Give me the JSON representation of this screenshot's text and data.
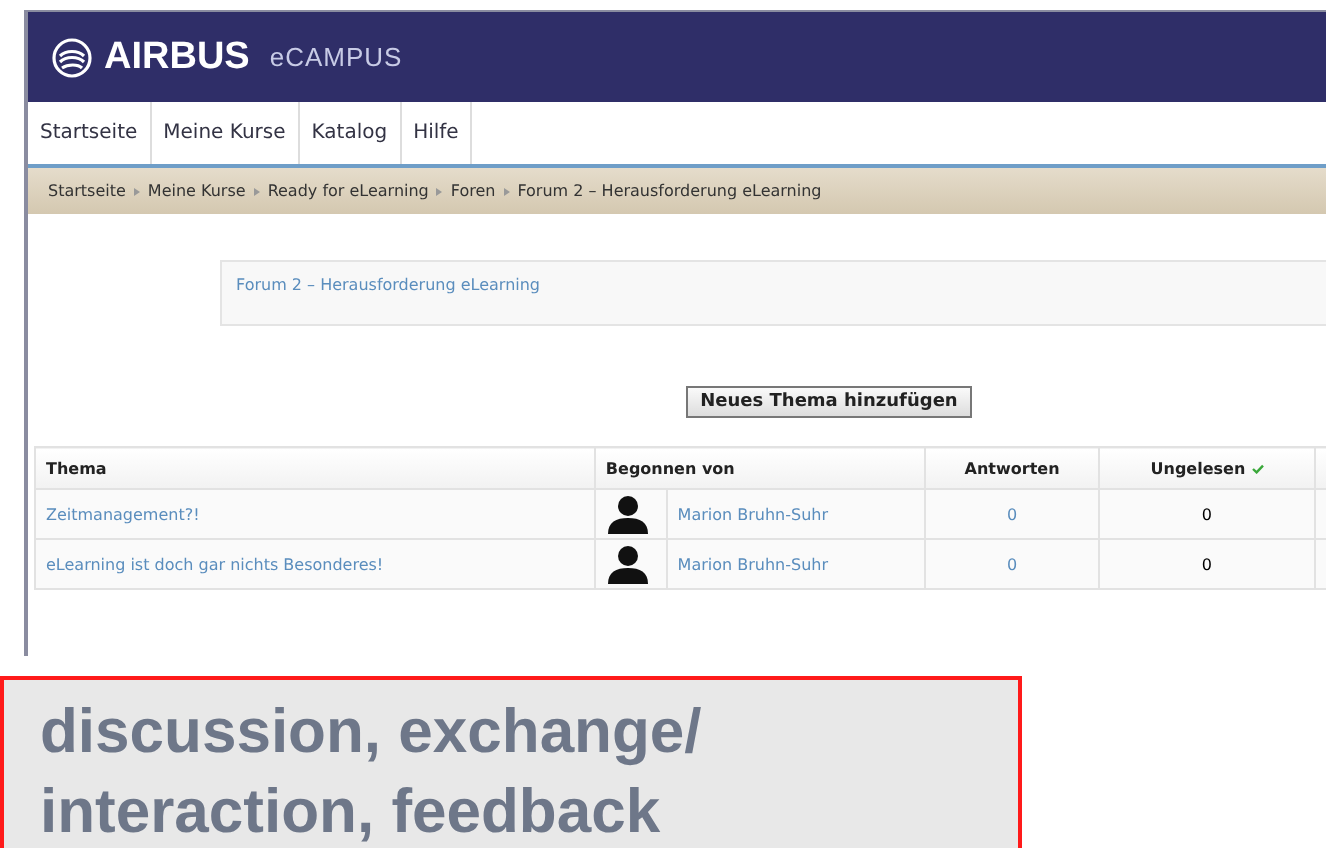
{
  "header": {
    "brand": "AIRBUS",
    "product": "eCAMPUS"
  },
  "nav": [
    {
      "label": "Startseite"
    },
    {
      "label": "Meine Kurse"
    },
    {
      "label": "Katalog"
    },
    {
      "label": "Hilfe"
    }
  ],
  "breadcrumb": [
    "Startseite",
    "Meine Kurse",
    "Ready for eLearning",
    "Foren",
    "Forum 2 – Herausforderung eLearning"
  ],
  "forum_intro": "Forum 2 – Herausforderung eLearning",
  "add_button": "Neues Thema hinzufügen",
  "table": {
    "columns": [
      "Thema",
      "Begonnen von",
      "Antworten",
      "Ungelesen"
    ],
    "rows": [
      {
        "topic": "Zeitmanagement?!",
        "author": "Marion Bruhn-Suhr",
        "replies": "0",
        "unread": "0"
      },
      {
        "topic": "eLearning ist doch gar nichts Besonderes!",
        "author": "Marion Bruhn-Suhr",
        "replies": "0",
        "unread": "0"
      }
    ]
  },
  "callout": "discussion, exchange/ interaction, feedback"
}
